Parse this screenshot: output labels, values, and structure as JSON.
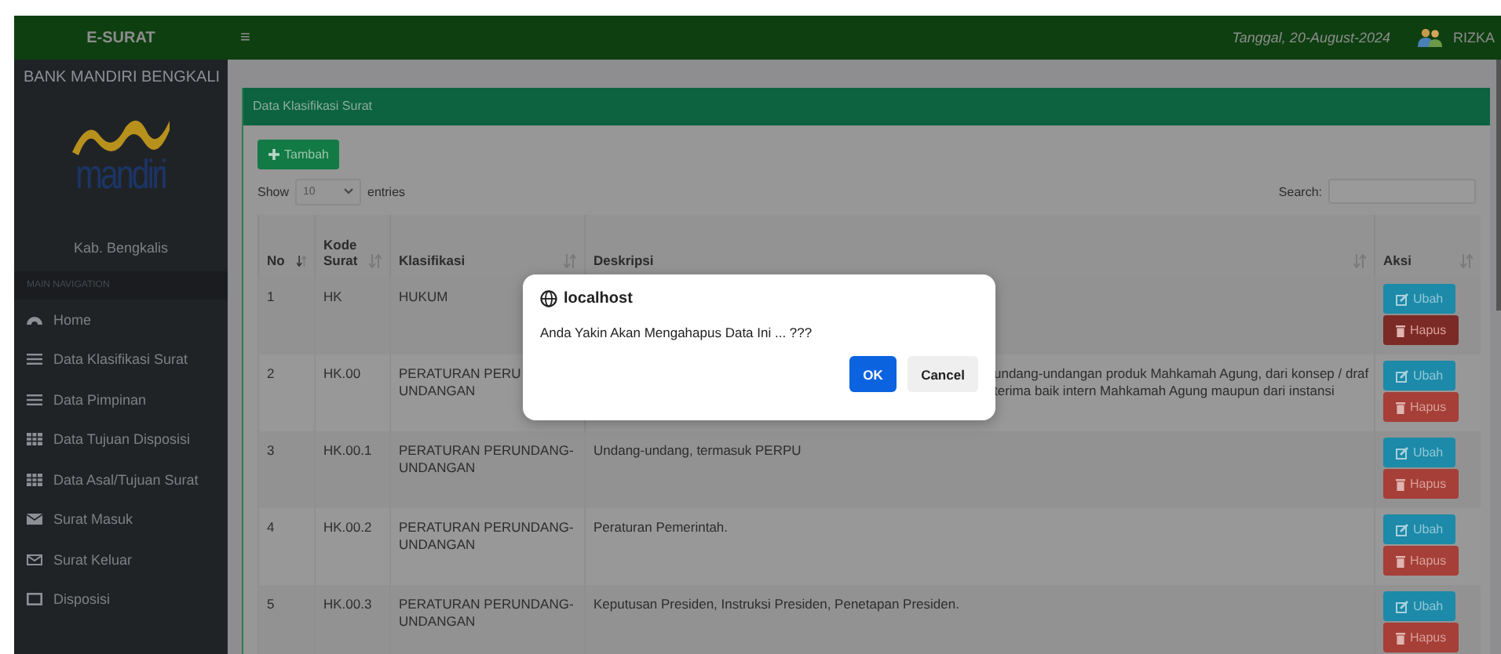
{
  "header": {
    "brand": "E-SURAT",
    "menu_glyph": "≡",
    "date": "Tanggal, 20-August-2024",
    "user": "RIZKA"
  },
  "sidebar": {
    "org": "BANK MANDIRI BENGKALI",
    "logo_text": "mandiri",
    "region": "Kab. Bengkalis",
    "section": "MAIN NAVIGATION",
    "items": [
      {
        "label": "Home",
        "kind": "gauge"
      },
      {
        "label": "Data Klasifikasi Surat",
        "kind": "list"
      },
      {
        "label": "Data Pimpinan",
        "kind": "list"
      },
      {
        "label": "Data Tujuan Disposisi",
        "kind": "grid"
      },
      {
        "label": "Data Asal/Tujuan Surat",
        "kind": "grid"
      },
      {
        "label": "Surat Masuk",
        "kind": "envelope"
      },
      {
        "label": "Surat Keluar",
        "kind": "envelope-outline"
      },
      {
        "label": "Disposisi",
        "kind": "square"
      }
    ]
  },
  "panel": {
    "title": "Data Klasifikasi Surat",
    "add_button": "Tambah",
    "show_label": "Show",
    "entries_value": "10",
    "entries_label": "entries",
    "search_label": "Search:"
  },
  "table": {
    "columns": [
      {
        "label": "No",
        "sorted": true
      },
      {
        "label": "Kode Surat",
        "sorted": false
      },
      {
        "label": "Klasifikasi",
        "sorted": false
      },
      {
        "label": "Deskripsi",
        "sorted": false
      },
      {
        "label": "Aksi",
        "sorted": false
      }
    ],
    "rows": [
      {
        "no": "1",
        "kode": "HK",
        "klasifikasi": [
          "HUKUM"
        ],
        "deskripsi": [],
        "edit": "Ubah",
        "delete": "Hapus"
      },
      {
        "no": "2",
        "kode": "HK.00",
        "klasifikasi": [
          "PERATURAN PERU",
          "UNDANGAN"
        ],
        "deskripsi": [
          "undang-undangan produk Mahkamah Agung, dari konsep / draf",
          "terima baik intern Mahkamah Agung maupun dari instansi"
        ],
        "partly_hidden": true,
        "edit": "Ubah",
        "delete": "Hapus"
      },
      {
        "no": "3",
        "kode": "HK.00.1",
        "klasifikasi": [
          "PERATURAN PERUNDANG-",
          "UNDANGAN"
        ],
        "deskripsi": [
          "Undang-undang, termasuk PERPU"
        ],
        "partly_hidden": false,
        "edit": "Ubah",
        "delete": "Hapus"
      },
      {
        "no": "4",
        "kode": "HK.00.2",
        "klasifikasi": [
          "PERATURAN PERUNDANG-",
          "UNDANGAN"
        ],
        "deskripsi": [
          "Peraturan Pemerintah."
        ],
        "partly_hidden": false,
        "edit": "Ubah",
        "delete": "Hapus"
      },
      {
        "no": "5",
        "kode": "HK.00.3",
        "klasifikasi": [
          "PERATURAN PERUNDANG-",
          "UNDANGAN"
        ],
        "deskripsi": [
          "Keputusan Presiden, Instruksi Presiden, Penetapan Presiden."
        ],
        "partly_hidden": false,
        "edit": "Ubah",
        "delete": "Hapus"
      }
    ]
  },
  "dialog": {
    "origin": "localhost",
    "message": "Anda Yakin Akan Mengahapus Data Ini ... ???",
    "ok": "OK",
    "cancel": "Cancel"
  }
}
